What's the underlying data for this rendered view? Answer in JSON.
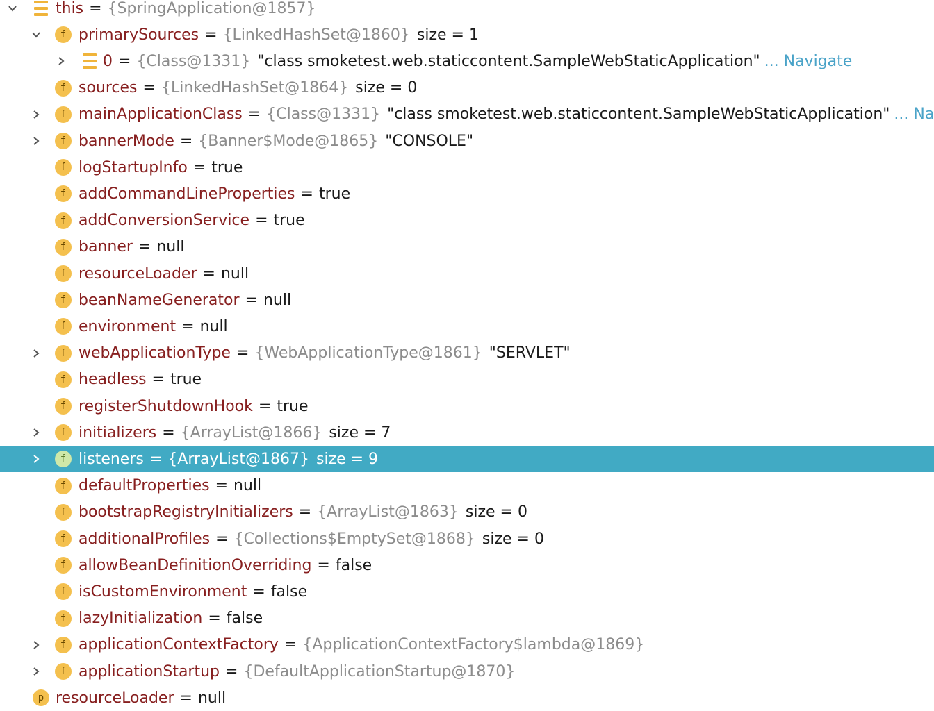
{
  "tree": [
    {
      "depth": 0,
      "arrow": "expanded",
      "icon": "list",
      "name": "this",
      "ref": "{SpringApplication@1857}",
      "value": "",
      "nav": ""
    },
    {
      "depth": 1,
      "arrow": "expanded",
      "icon": "f",
      "name": "primarySources",
      "ref": "{LinkedHashSet@1860}",
      "value": "size = 1",
      "nav": ""
    },
    {
      "depth": 2,
      "arrow": "collapsed",
      "icon": "list",
      "name": "0",
      "ref": "{Class@1331}",
      "value": "\"class smoketest.web.staticcontent.SampleWebStaticApplication\"",
      "nav": "... Navigate"
    },
    {
      "depth": 1,
      "arrow": "none",
      "icon": "f",
      "name": "sources",
      "ref": "{LinkedHashSet@1864}",
      "value": "size = 0",
      "nav": ""
    },
    {
      "depth": 1,
      "arrow": "collapsed",
      "icon": "f",
      "name": "mainApplicationClass",
      "ref": "{Class@1331}",
      "value": "\"class smoketest.web.staticcontent.SampleWebStaticApplication\"",
      "nav": "... Navi"
    },
    {
      "depth": 1,
      "arrow": "collapsed",
      "icon": "f",
      "name": "bannerMode",
      "ref": "{Banner$Mode@1865}",
      "value": "\"CONSOLE\"",
      "nav": ""
    },
    {
      "depth": 1,
      "arrow": "none",
      "icon": "f",
      "name": "logStartupInfo",
      "ref": "",
      "value": "true",
      "nav": ""
    },
    {
      "depth": 1,
      "arrow": "none",
      "icon": "f",
      "name": "addCommandLineProperties",
      "ref": "",
      "value": "true",
      "nav": ""
    },
    {
      "depth": 1,
      "arrow": "none",
      "icon": "f",
      "name": "addConversionService",
      "ref": "",
      "value": "true",
      "nav": ""
    },
    {
      "depth": 1,
      "arrow": "none",
      "icon": "f",
      "name": "banner",
      "ref": "",
      "value": "null",
      "nav": ""
    },
    {
      "depth": 1,
      "arrow": "none",
      "icon": "f",
      "name": "resourceLoader",
      "ref": "",
      "value": "null",
      "nav": ""
    },
    {
      "depth": 1,
      "arrow": "none",
      "icon": "f",
      "name": "beanNameGenerator",
      "ref": "",
      "value": "null",
      "nav": ""
    },
    {
      "depth": 1,
      "arrow": "none",
      "icon": "f",
      "name": "environment",
      "ref": "",
      "value": "null",
      "nav": ""
    },
    {
      "depth": 1,
      "arrow": "collapsed",
      "icon": "f",
      "name": "webApplicationType",
      "ref": "{WebApplicationType@1861}",
      "value": "\"SERVLET\"",
      "nav": ""
    },
    {
      "depth": 1,
      "arrow": "none",
      "icon": "f",
      "name": "headless",
      "ref": "",
      "value": "true",
      "nav": ""
    },
    {
      "depth": 1,
      "arrow": "none",
      "icon": "f",
      "name": "registerShutdownHook",
      "ref": "",
      "value": "true",
      "nav": ""
    },
    {
      "depth": 1,
      "arrow": "collapsed",
      "icon": "f",
      "name": "initializers",
      "ref": "{ArrayList@1866}",
      "value": "size = 7",
      "nav": ""
    },
    {
      "depth": 1,
      "arrow": "collapsed",
      "icon": "f",
      "name": "listeners",
      "ref": "{ArrayList@1867}",
      "value": "size = 9",
      "nav": "",
      "selected": true
    },
    {
      "depth": 1,
      "arrow": "none",
      "icon": "f",
      "name": "defaultProperties",
      "ref": "",
      "value": "null",
      "nav": ""
    },
    {
      "depth": 1,
      "arrow": "none",
      "icon": "f",
      "name": "bootstrapRegistryInitializers",
      "ref": "{ArrayList@1863}",
      "value": "size = 0",
      "nav": ""
    },
    {
      "depth": 1,
      "arrow": "none",
      "icon": "f",
      "name": "additionalProfiles",
      "ref": "{Collections$EmptySet@1868}",
      "value": "size = 0",
      "nav": ""
    },
    {
      "depth": 1,
      "arrow": "none",
      "icon": "f",
      "name": "allowBeanDefinitionOverriding",
      "ref": "",
      "value": "false",
      "nav": ""
    },
    {
      "depth": 1,
      "arrow": "none",
      "icon": "f",
      "name": "isCustomEnvironment",
      "ref": "",
      "value": "false",
      "nav": ""
    },
    {
      "depth": 1,
      "arrow": "none",
      "icon": "f",
      "name": "lazyInitialization",
      "ref": "",
      "value": "false",
      "nav": ""
    },
    {
      "depth": 1,
      "arrow": "collapsed",
      "icon": "f",
      "name": "applicationContextFactory",
      "ref": "{ApplicationContextFactory$lambda@1869}",
      "value": "",
      "nav": ""
    },
    {
      "depth": 1,
      "arrow": "collapsed",
      "icon": "f",
      "name": "applicationStartup",
      "ref": "{DefaultApplicationStartup@1870}",
      "value": "",
      "nav": ""
    },
    {
      "depth": 0,
      "arrow": "none",
      "icon": "p",
      "name": "resourceLoader",
      "ref": "",
      "value": "null",
      "nav": ""
    }
  ],
  "equals": "=",
  "colors": {
    "selection": "#41aac4",
    "field_name": "#871f1f",
    "reference": "#8c8c8c",
    "navigate_link": "#4aa3c8",
    "badge": "#f4c04e"
  }
}
